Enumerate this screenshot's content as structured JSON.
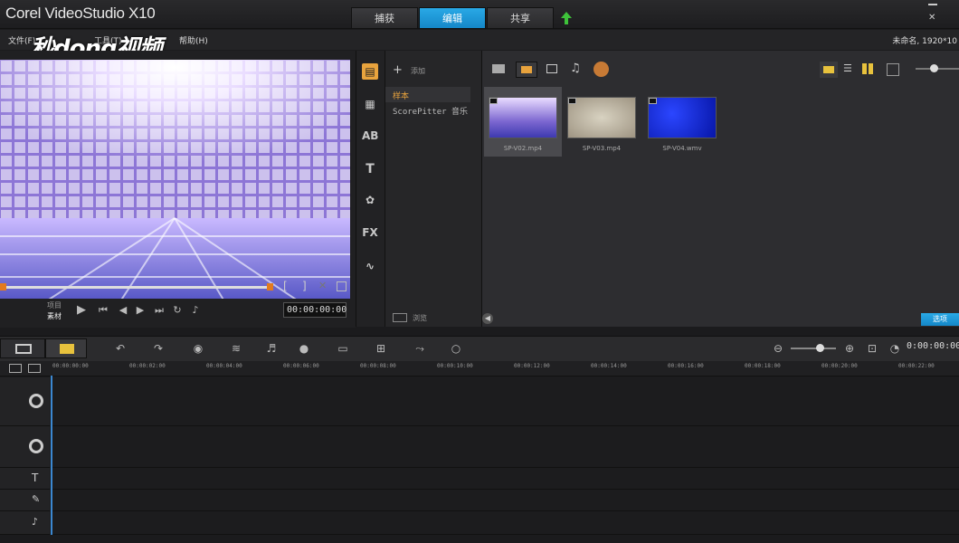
{
  "app": {
    "title": "Corel VideoStudio X10"
  },
  "mode_tabs": [
    {
      "label": "捕获"
    },
    {
      "label": "编辑"
    },
    {
      "label": "共享"
    }
  ],
  "menu": [
    {
      "label": "文件(F)"
    },
    {
      "label": "工具(T)"
    },
    {
      "label": "帮助(H)"
    }
  ],
  "project_info": "未命名, 1920*10",
  "watermark": "秒dong视频",
  "player": {
    "mode_labels": {
      "project": "项目",
      "clip": "素材"
    },
    "timecode": "00:00:00:00",
    "mark_in": "[",
    "mark_out": "]"
  },
  "library": {
    "add_label": "添加",
    "folders": [
      {
        "label": "样本"
      },
      {
        "label": "ScorePitter 音乐"
      }
    ],
    "browse_label": "浏览",
    "options_label": "选项",
    "thumbnails": [
      {
        "caption": "SP-V02.mp4"
      },
      {
        "caption": "SP-V03.mp4"
      },
      {
        "caption": "SP-V04.wmv"
      }
    ]
  },
  "timeline": {
    "timecode": "0:00:00:00",
    "ruler": [
      "00:00:00:00",
      "00:00:02:00",
      "00:00:04:00",
      "00:00:06:00",
      "00:00:08:00",
      "00:00:10:00",
      "00:00:12:00",
      "00:00:14:00",
      "00:00:16:00",
      "00:00:18:00",
      "00:00:20:00",
      "00:00:22:00"
    ]
  },
  "colors": {
    "accent": "#1a9ad9",
    "active_folder": "#e8a33d"
  }
}
